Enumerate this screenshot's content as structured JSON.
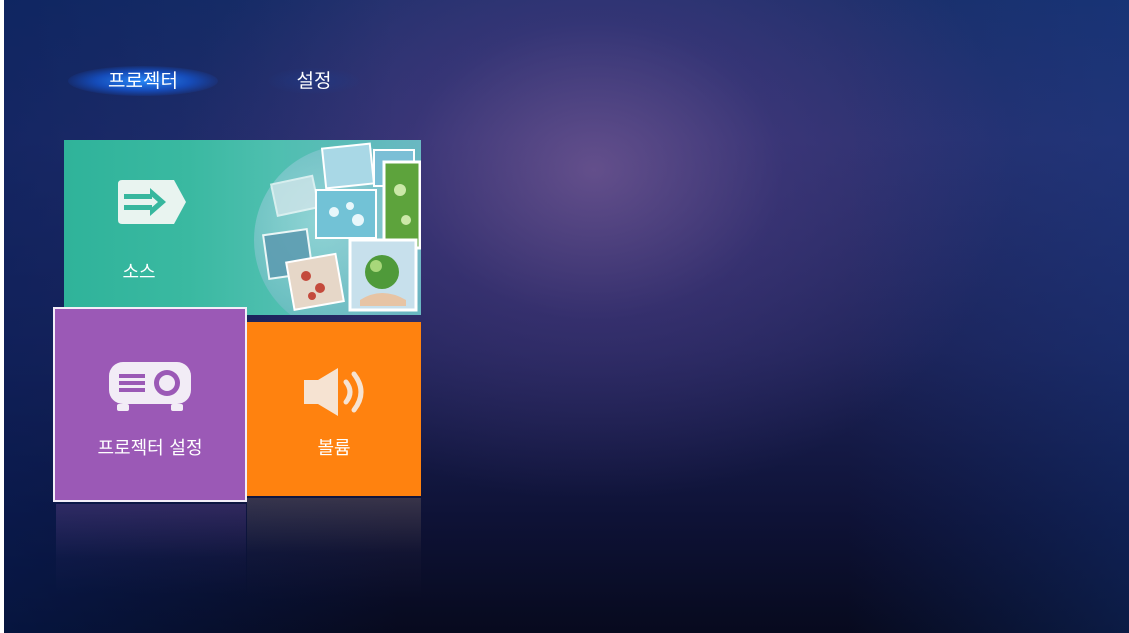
{
  "tabs": {
    "projector": "프로젝터",
    "settings": "설정"
  },
  "tiles": {
    "source": {
      "label": "소스",
      "icon": "input-source-icon",
      "color": "#37b79e"
    },
    "projector_settings": {
      "label": "프로젝터 설정",
      "icon": "projector-icon",
      "color": "#9b59b6"
    },
    "volume": {
      "label": "볼륨",
      "icon": "speaker-volume-icon",
      "color": "#ff820f"
    }
  },
  "selected_tile": "projector_settings",
  "active_tab": "projector"
}
